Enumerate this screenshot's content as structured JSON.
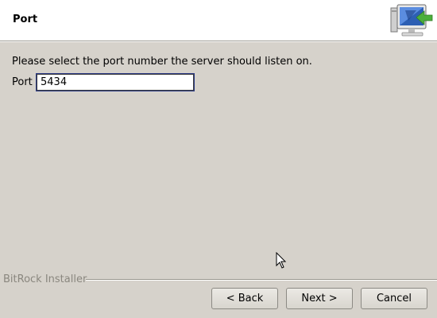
{
  "header": {
    "title": "Port",
    "icon": "installer-computer-icon"
  },
  "main": {
    "instruction": "Please select the port number the server should listen on.",
    "port_label": "Port",
    "port_value": "5434"
  },
  "footer": {
    "brand": "BitRock Installer",
    "back_label": "< Back",
    "next_label": "Next >",
    "cancel_label": "Cancel"
  },
  "colors": {
    "background": "#d6d2cb",
    "header_background": "#ffffff",
    "input_focus_border": "#2b3a86",
    "brand_text": "#8a877f",
    "icon_arrow": "#4caf3c"
  }
}
